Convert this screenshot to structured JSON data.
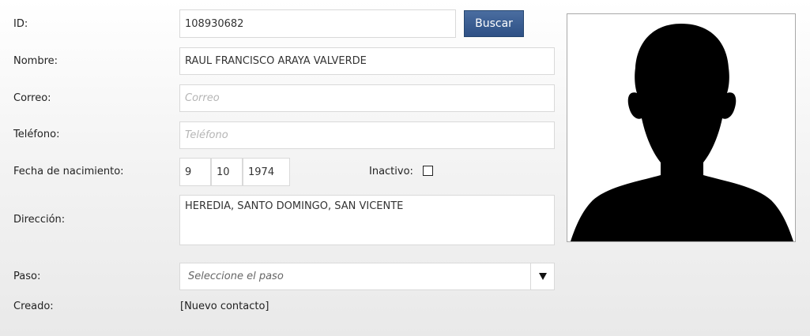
{
  "form": {
    "id": {
      "label": "ID:",
      "value": "108930682",
      "search_label": "Buscar"
    },
    "nombre": {
      "label": "Nombre:",
      "value": "RAUL FRANCISCO ARAYA VALVERDE"
    },
    "correo": {
      "label": "Correo:",
      "value": "",
      "placeholder": "Correo"
    },
    "telefono": {
      "label": "Teléfono:",
      "value": "",
      "placeholder": "Teléfono"
    },
    "fecha_nacimiento": {
      "label": "Fecha de nacimiento:",
      "day": "9",
      "month": "10",
      "year": "1974"
    },
    "inactivo": {
      "label": "Inactivo:",
      "checked": false
    },
    "direccion": {
      "label": "Dirección:",
      "value": "HEREDIA, SANTO DOMINGO, SAN VICENTE"
    },
    "paso": {
      "label": "Paso:",
      "selected": "Seleccione el paso",
      "arrow_icon": "triangle-down-icon"
    },
    "creado": {
      "label": "Creado:",
      "value": "[Nuevo contacto]"
    }
  },
  "photo": {
    "icon": "person-silhouette-icon"
  }
}
